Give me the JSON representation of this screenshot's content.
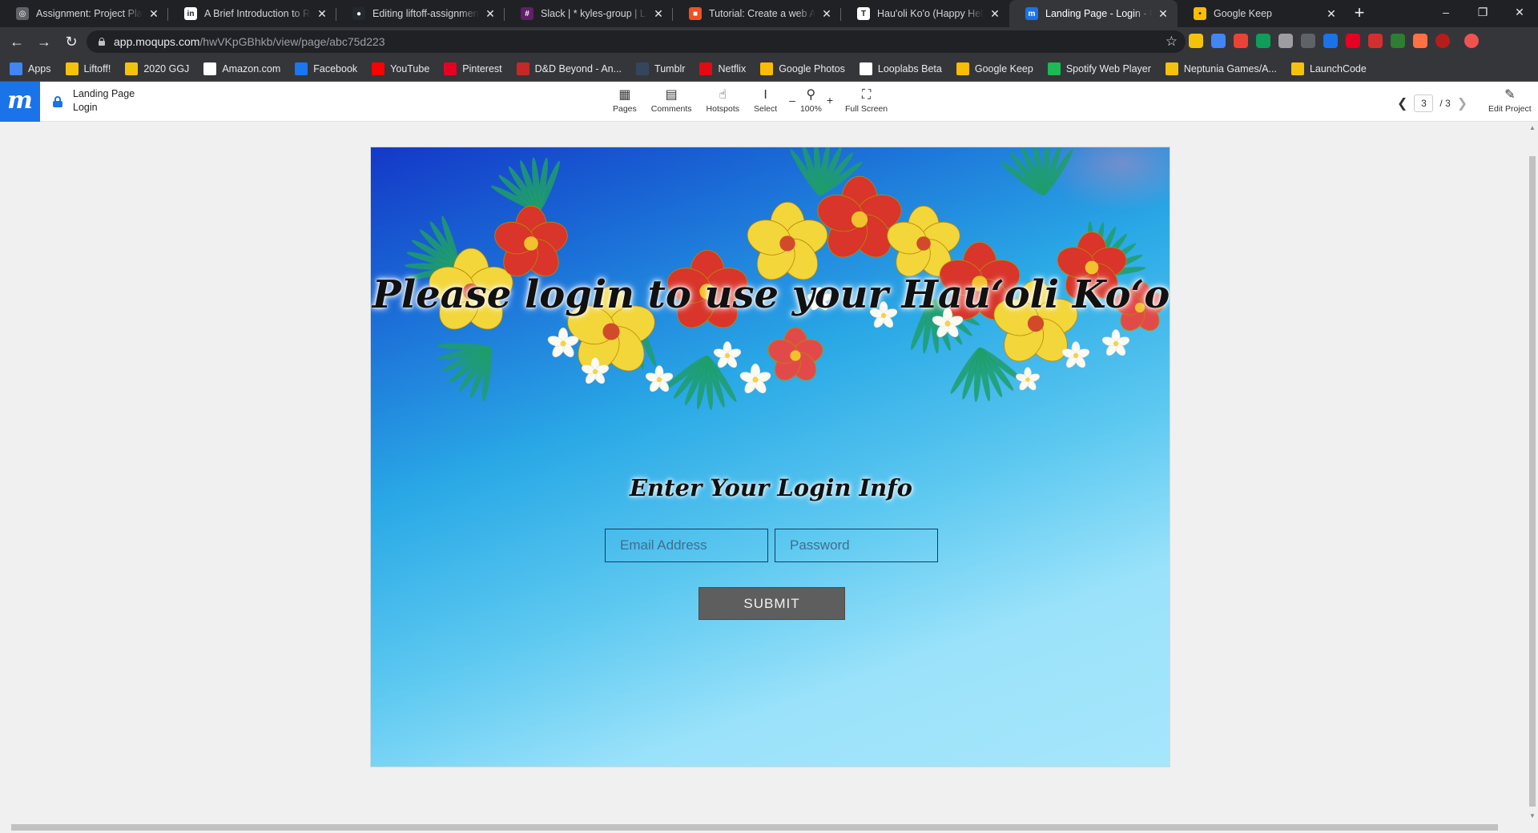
{
  "browser": {
    "tabs": [
      {
        "title": "Assignment: Project Plannin",
        "color": "#5f6368",
        "glyph": "◎"
      },
      {
        "title": "A Brief Introduction to REST",
        "color": "#ffffff",
        "glyph": "in"
      },
      {
        "title": "Editing liftoff-assignments/",
        "color": "#24292e",
        "glyph": "●"
      },
      {
        "title": "Slack | * kyles-group | Liftof",
        "color": "#611f69",
        "glyph": "#"
      },
      {
        "title": "Tutorial: Create a web API w",
        "color": "#f25022",
        "glyph": "■"
      },
      {
        "title": "Hau'oli Ko'o (Happy Helper)",
        "color": "#ffffff",
        "glyph": "T"
      },
      {
        "title": "Landing Page - Login - Moq",
        "color": "#1a73e8",
        "glyph": "m"
      },
      {
        "title": "Google Keep",
        "color": "#fbbc04",
        "glyph": "•"
      }
    ],
    "new_tab": "+",
    "window_controls": [
      "–",
      "❐",
      "✕"
    ],
    "url_host": "app.moqups.com",
    "url_path": "/hwVKpGBhkb/view/page/abc75d223",
    "extensions": [
      {
        "color": "#f4c20d"
      },
      {
        "color": "#4285f4"
      },
      {
        "color": "#ea4335"
      },
      {
        "color": "#0f9d58"
      },
      {
        "color": "#9e9e9e"
      },
      {
        "color": "#5f6368"
      },
      {
        "color": "#1a73e8"
      },
      {
        "color": "#e60023"
      },
      {
        "color": "#d32f2f"
      },
      {
        "color": "#2e7d32"
      },
      {
        "color": "#ff7043"
      },
      {
        "color": "#b71c1c"
      },
      {
        "color": "#ef5350"
      }
    ],
    "bookmarks": [
      {
        "label": "Apps",
        "color": "#4285f4"
      },
      {
        "label": "Liftoff!",
        "color": "#f4c20d"
      },
      {
        "label": "2020 GGJ",
        "color": "#f4c20d"
      },
      {
        "label": "Amazon.com",
        "color": "#ffffff"
      },
      {
        "label": "Facebook",
        "color": "#1877f2"
      },
      {
        "label": "YouTube",
        "color": "#ff0000"
      },
      {
        "label": "Pinterest",
        "color": "#e60023"
      },
      {
        "label": "D&D Beyond - An...",
        "color": "#c62828"
      },
      {
        "label": "Tumblr",
        "color": "#35465c"
      },
      {
        "label": "Netflix",
        "color": "#e50914"
      },
      {
        "label": "Google Photos",
        "color": "#fbbc04"
      },
      {
        "label": "Looplabs Beta",
        "color": "#ffffff"
      },
      {
        "label": "Google Keep",
        "color": "#fbbc04"
      },
      {
        "label": "Spotify Web Player",
        "color": "#1db954"
      },
      {
        "label": "Neptunia Games/A...",
        "color": "#f4c20d"
      },
      {
        "label": "LaunchCode",
        "color": "#f4c20d"
      }
    ]
  },
  "moqups": {
    "logo": "m",
    "title_line1": "Landing Page",
    "title_line2": "Login",
    "tools": {
      "pages": "Pages",
      "comments": "Comments",
      "hotspots": "Hotspots",
      "select": "Select",
      "zoom_out": "–",
      "zoom_level": "100%",
      "zoom_in": "+",
      "full_screen": "Full Screen"
    },
    "page_current": "3",
    "page_total": "/ 3",
    "edit_project": "Edit Project"
  },
  "mockup": {
    "headline": "Please login to use your Hauʻoli Koʻo",
    "subhead": "Enter Your Login Info",
    "email_placeholder": "Email Address",
    "password_placeholder": "Password",
    "submit_label": "SUBMIT"
  }
}
